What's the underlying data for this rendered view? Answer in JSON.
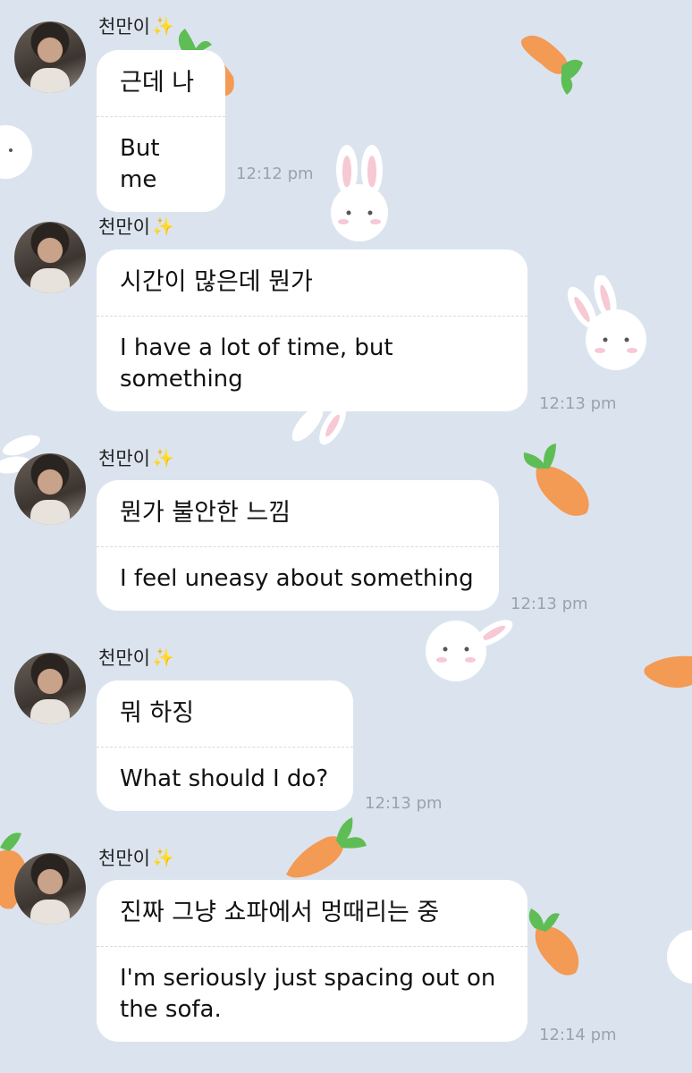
{
  "messages": [
    {
      "sender": "천만이",
      "korean": "근데 나",
      "english": "But me",
      "time": "12:12 pm"
    },
    {
      "sender": "천만이",
      "korean": "시간이 많은데 뭔가",
      "english": "I have a lot of time, but something",
      "time": "12:13 pm"
    },
    {
      "sender": "천만이",
      "korean": "뭔가 불안한 느낌",
      "english": "I feel uneasy about something",
      "time": "12:13 pm"
    },
    {
      "sender": "천만이",
      "korean": "뭐 하징",
      "english": "What should I do?",
      "time": "12:13 pm"
    },
    {
      "sender": "천만이",
      "korean": "진짜 그냥 쇼파에서 멍때리는 중",
      "english": "I'm seriously just spacing out on the sofa.",
      "time": "12:14 pm"
    }
  ],
  "sender_emoji": "✨",
  "colors": {
    "background": "#dbe4ee",
    "bubble": "#ffffff",
    "timestamp": "#9aa3ad",
    "carrot": "#f39a55",
    "leaf": "#5fbd55"
  },
  "background_icons": [
    "bunny-icon",
    "carrot-icon"
  ]
}
